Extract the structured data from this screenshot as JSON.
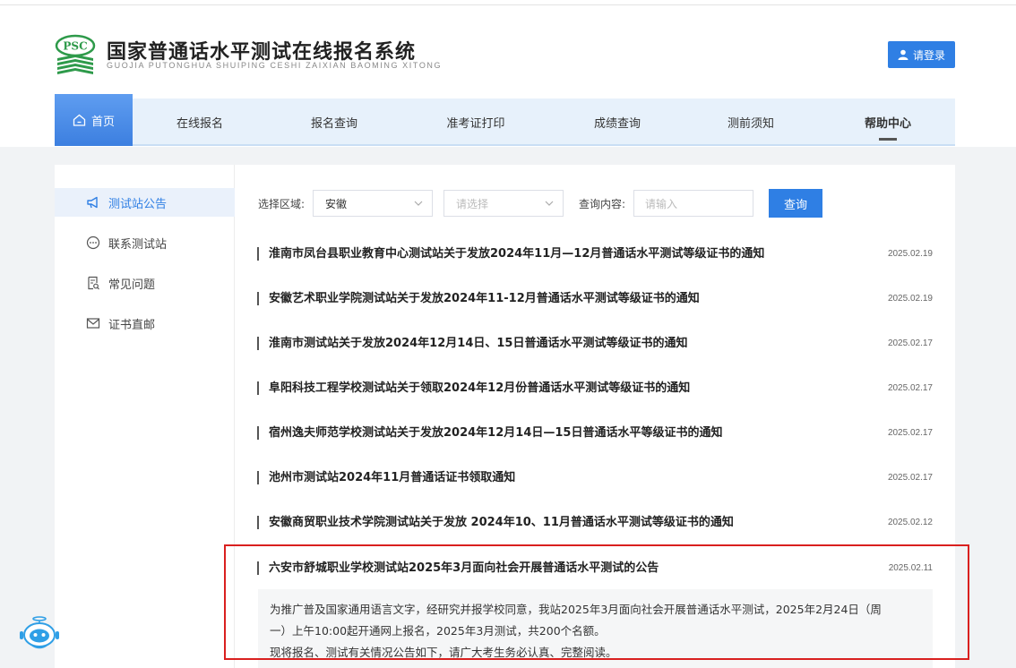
{
  "header": {
    "logo_text": "PSC",
    "title": "国家普通话水平测试在线报名系统",
    "subtitle": "GUOJIA PUTONGHUA SHUIPING CESHI ZAIXIAN BAOMING XITONG",
    "login_label": "请登录"
  },
  "nav": {
    "items": [
      {
        "label": "首页",
        "icon": "home-icon"
      },
      {
        "label": "在线报名"
      },
      {
        "label": "报名查询"
      },
      {
        "label": "准考证打印"
      },
      {
        "label": "成绩查询"
      },
      {
        "label": "测前须知"
      },
      {
        "label": "帮助中心"
      }
    ],
    "active_index": 0
  },
  "sidebar": {
    "items": [
      {
        "label": "测试站公告",
        "icon": "megaphone-icon",
        "active": true
      },
      {
        "label": "联系测试站",
        "icon": "chat-bubble-icon"
      },
      {
        "label": "常见问题",
        "icon": "document-search-icon"
      },
      {
        "label": "证书直邮",
        "icon": "mail-icon"
      }
    ]
  },
  "filter": {
    "region_label": "选择区域:",
    "province_value": "安徽",
    "city_placeholder": "请选择",
    "content_label": "查询内容:",
    "content_placeholder": "请输入",
    "query_label": "查询"
  },
  "notices": [
    {
      "title": "淮南市凤台县职业教育中心测试站关于发放2024年11月—12月普通话水平测试等级证书的通知",
      "date": "2025.02.19"
    },
    {
      "title": "安徽艺术职业学院测试站关于发放2024年11-12月普通话水平测试等级证书的通知",
      "date": "2025.02.19"
    },
    {
      "title": "淮南市测试站关于发放2024年12月14日、15日普通话水平测试等级证书的通知",
      "date": "2025.02.17"
    },
    {
      "title": "阜阳科技工程学校测试站关于领取2024年12月份普通话水平测试等级证书的通知",
      "date": "2025.02.17"
    },
    {
      "title": "宿州逸夫师范学校测试站关于发放2024年12月14日—15日普通话水平等级证书的通知",
      "date": "2025.02.17"
    },
    {
      "title": "池州市测试站2024年11月普通话证书领取通知",
      "date": "2025.02.17"
    },
    {
      "title": "安徽商贸职业技术学院测试站关于发放 2024年10、11月普通话水平测试等级证书的通知",
      "date": "2025.02.12"
    },
    {
      "title": "六安市舒城职业学校测试站2025年3月面向社会开展普通话水平测试的公告",
      "date": "2025.02.11"
    }
  ],
  "expanded_notice": {
    "lines": [
      "为推广普及国家通用语言文字，经研究并报学校同意，我站2025年3月面向社会开展普通话水平测试，2025年2月24日（周",
      "一）上午10:00起开通网上报名，2025年3月测试，共200个名额。",
      "现将报名、测试有关情况公告如下，请广大考生务必认真、完整阅读。"
    ]
  },
  "colors": {
    "primary": "#2f7fe4",
    "nav_bg": "#e7f1fb",
    "highlight": "#d9201f",
    "logo_green": "#2e9a4a"
  }
}
